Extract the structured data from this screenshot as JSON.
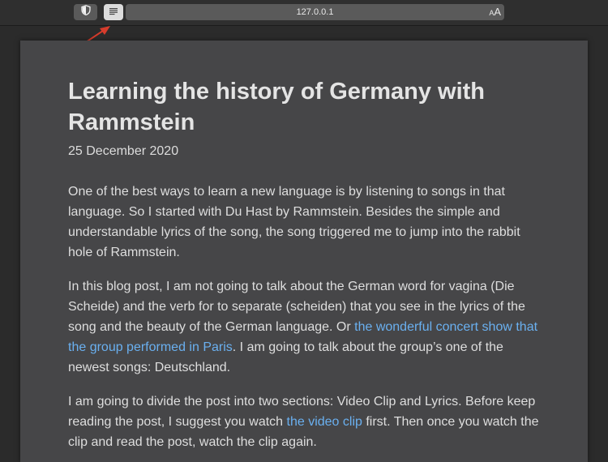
{
  "toolbar": {
    "privacy_icon": "shield-icon",
    "reader_icon": "reader-mode-icon",
    "url": "127.0.0.1",
    "text_size_small": "A",
    "text_size_large": "A"
  },
  "annotation": {
    "arrow_color": "#d63c2c"
  },
  "article": {
    "title": "Learning the history of Germany with Rammstein",
    "date": "25 December 2020",
    "para1": "One of the best ways to learn a new language is by listening to songs in that language. So I started with Du Hast by Rammstein. Besides the simple and understandable lyrics of the song, the song triggered me to jump into the rabbit hole of Rammstein.",
    "para2_a": "In this blog post, I am not going to talk about the German word for vagina (Die Scheide) and the verb for to separate (scheiden) that you see in the lyrics of the song and the beauty of the German language. Or ",
    "para2_link": "the wonderful concert show that the group performed in Paris",
    "para2_b": ". I am going to talk about the group’s one of the newest songs: Deutschland.",
    "para3_a": "I am going to divide the post into two sections: Video Clip and Lyrics. Before keep reading the post, I suggest you watch ",
    "para3_link": "the video clip",
    "para3_b": " first. Then once you watch the clip and read the post, watch the clip again."
  },
  "colors": {
    "link": "#6ab0f0",
    "article_bg": "#464648",
    "page_bg": "#2b2b2b"
  }
}
